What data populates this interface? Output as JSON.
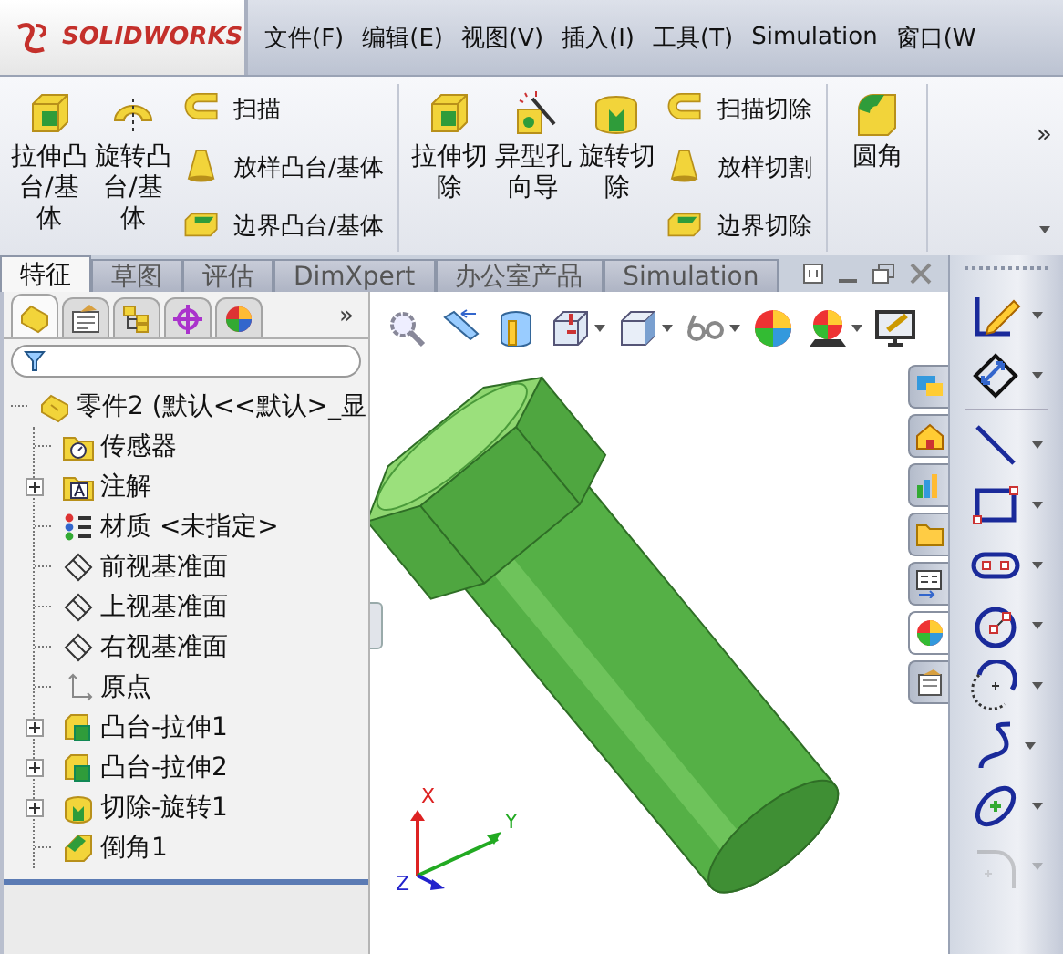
{
  "logo": {
    "text": "SOLIDWORKS"
  },
  "menu": [
    "文件(F)",
    "编辑(E)",
    "视图(V)",
    "插入(I)",
    "工具(T)",
    "Simulation",
    "窗口(W"
  ],
  "ribbon": {
    "groups": [
      {
        "items": [
          {
            "kind": "large",
            "label": "拉伸凸台/基体"
          },
          {
            "kind": "large",
            "label": "旋转凸台/基体"
          },
          {
            "kind": "stack",
            "items": [
              "扫描",
              "放样凸台/基体",
              "边界凸台/基体"
            ]
          }
        ]
      },
      {
        "items": [
          {
            "kind": "large",
            "label": "拉伸切除"
          },
          {
            "kind": "large",
            "label": "异型孔向导"
          },
          {
            "kind": "large",
            "label": "旋转切除"
          },
          {
            "kind": "stack",
            "items": [
              "扫描切除",
              "放样切割",
              "边界切除"
            ]
          }
        ]
      },
      {
        "items": [
          {
            "kind": "large",
            "label": "圆角"
          }
        ]
      }
    ],
    "overflow": "»"
  },
  "tabs": [
    {
      "label": "特征",
      "selected": true
    },
    {
      "label": "草图",
      "selected": false
    },
    {
      "label": "评估",
      "selected": false
    },
    {
      "label": "DimXpert",
      "selected": false
    },
    {
      "label": "办公室产品",
      "selected": false
    },
    {
      "label": "Simulation",
      "selected": false
    }
  ],
  "panel_tabs": [
    {
      "selected": true
    },
    {
      "selected": false
    },
    {
      "selected": false
    },
    {
      "selected": false
    },
    {
      "selected": false
    }
  ],
  "panel_overflow": "»",
  "tree": [
    {
      "kind": "part",
      "label": "零件2  (默认<<默认>_显",
      "children": [
        {
          "kind": "sensors",
          "label": "传感器"
        },
        {
          "kind": "annotations",
          "label": "注解",
          "expanded": false
        },
        {
          "kind": "material",
          "label": "材质 <未指定>"
        },
        {
          "kind": "plane",
          "label": "前视基准面"
        },
        {
          "kind": "plane",
          "label": "上视基准面"
        },
        {
          "kind": "plane",
          "label": "右视基准面"
        },
        {
          "kind": "origin",
          "label": "原点"
        },
        {
          "kind": "extrude",
          "label": "凸台-拉伸1",
          "expanded": false
        },
        {
          "kind": "extrude",
          "label": "凸台-拉伸2",
          "expanded": false
        },
        {
          "kind": "revolve",
          "label": "切除-旋转1",
          "expanded": false
        },
        {
          "kind": "fillet",
          "label": "倒角1"
        }
      ]
    }
  ],
  "triad": [
    "X",
    "Y",
    "Z"
  ],
  "task_tabs": [
    {
      "selected": false
    },
    {
      "selected": false
    },
    {
      "selected": false
    },
    {
      "selected": false
    },
    {
      "selected": false
    },
    {
      "selected": true
    },
    {
      "selected": false
    }
  ],
  "sketch_tools": [
    {
      "disabled": false
    },
    {
      "disabled": false
    },
    {
      "disabled": false
    },
    {
      "disabled": false
    },
    {
      "disabled": false
    },
    {
      "disabled": false
    },
    {
      "disabled": false
    },
    {
      "disabled": false
    },
    {
      "disabled": false
    },
    {
      "disabled": true
    }
  ]
}
